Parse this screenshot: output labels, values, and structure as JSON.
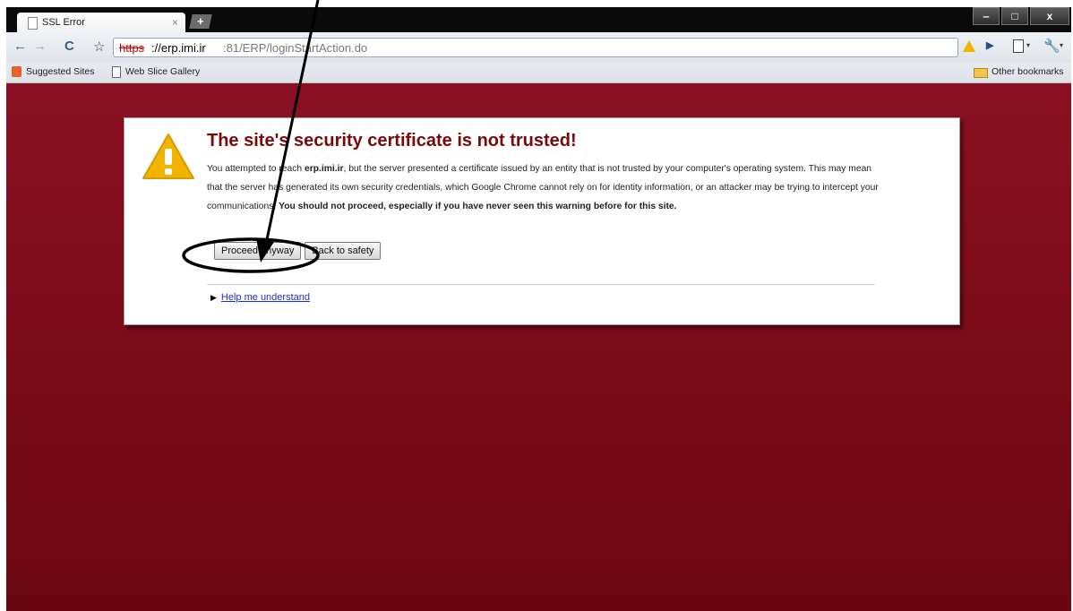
{
  "tab": {
    "title": "SSL Error",
    "close": "×",
    "new_tab": "+"
  },
  "window_controls": {
    "minimize": "‒",
    "maximize": "□",
    "close": "x"
  },
  "toolbar": {
    "back": "←",
    "forward": "→",
    "reload": "C",
    "star": "☆",
    "url_scheme": "https",
    "url_host": "://erp.imi.ir",
    "url_path": ":81/ERP/loginStartAction.do",
    "page_menu_dropdown": "▾",
    "wrench_dropdown": "▾"
  },
  "bookmarks": {
    "items": [
      "Suggested Sites",
      "Web Slice Gallery"
    ],
    "other": "Other bookmarks"
  },
  "error": {
    "heading": "The site's security certificate is not trusted!",
    "body_prefix": "You attempted to reach ",
    "body_host": "erp.imi.ir",
    "body_mid1": ", but the server presented a certificate issued by an entity that is not trusted by your computer's operating system. This may mean that the server has generated its own security credentials, which Google Chrome cannot rely on for identity information, or an attacker may be trying to intercept your communications. ",
    "body_bold": "You should not proceed, especially if you have never seen this warning before for this site.",
    "proceed_label": "Proceed anyway",
    "back_label": "Back to safety",
    "help_label": "Help me understand"
  },
  "colors": {
    "page_background": "#7e0c1b",
    "heading": "#7a0a0a",
    "link": "#1a2dd8",
    "warning_icon": "#f0b400"
  }
}
